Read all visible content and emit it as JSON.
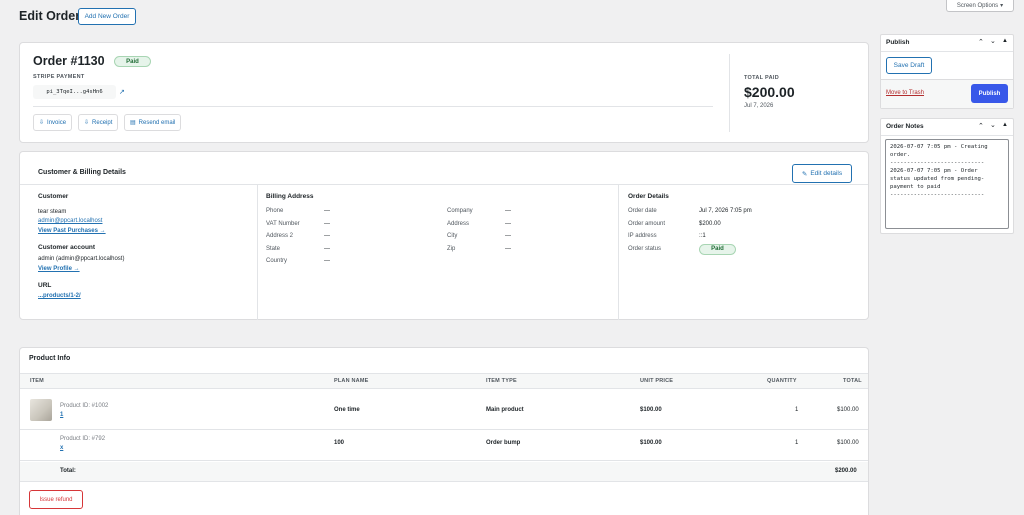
{
  "header": {
    "title": "Edit Order",
    "add_new_label": "Add New Order",
    "screen_options_label": "Screen Options"
  },
  "order": {
    "title": "Order #1130",
    "status_badge": "Paid",
    "payment_label": "STRIPE PAYMENT",
    "payment_id": "pi_3TqeI...g4sHn6",
    "invoice_label": "Invoice",
    "receipt_label": "Receipt",
    "resend_label": "Resend email",
    "total_paid_label": "TOTAL PAID",
    "total_paid": "$200.00",
    "date": "Jul 7, 2026"
  },
  "customer_section": {
    "title": "Customer & Billing Details",
    "edit_label": "Edit details",
    "customer_heading": "Customer",
    "customer_name": "tear steam",
    "customer_email": "admin@ppcart.localhost",
    "view_purchases": "View Past Purchases →",
    "account_heading": "Customer account",
    "account_value": "admin (admin@ppcart.localhost)",
    "view_profile": "View Profile →",
    "url_heading": "URL",
    "url_value": "...products/1-2/",
    "billing_heading": "Billing Address",
    "billing_left": [
      {
        "label": "Phone",
        "value": "—"
      },
      {
        "label": "VAT Number",
        "value": "—"
      },
      {
        "label": "Address 2",
        "value": "—"
      },
      {
        "label": "State",
        "value": "—"
      },
      {
        "label": "Country",
        "value": "—"
      }
    ],
    "billing_right": [
      {
        "label": "Company",
        "value": "—"
      },
      {
        "label": "Address",
        "value": "—"
      },
      {
        "label": "City",
        "value": "—"
      },
      {
        "label": "Zip",
        "value": "—"
      }
    ],
    "order_details_heading": "Order Details",
    "order_details": [
      {
        "label": "Order date",
        "value": "Jul 7, 2026 7:05 pm"
      },
      {
        "label": "Order amount",
        "value": "$200.00"
      },
      {
        "label": "IP address",
        "value": "::1"
      },
      {
        "label": "Order status",
        "value": "Paid"
      }
    ]
  },
  "products": {
    "title": "Product Info",
    "columns": [
      "ITEM",
      "PLAN NAME",
      "ITEM TYPE",
      "UNIT PRICE",
      "QUANTITY",
      "TOTAL"
    ],
    "rows": [
      {
        "product_id": "Product ID: #1002",
        "link": "1",
        "plan": "One time",
        "type": "Main product",
        "unit": "$100.00",
        "qty": "1",
        "total": "$100.00"
      },
      {
        "product_id": "Product ID: #792",
        "link": "x",
        "plan": "100",
        "type": "Order bump",
        "unit": "$100.00",
        "qty": "1",
        "total": "$100.00"
      }
    ],
    "total_label": "Total:",
    "total_value": "$200.00",
    "refund_label": "Issue refund"
  },
  "publish": {
    "title": "Publish",
    "save_draft": "Save Draft",
    "trash": "Move to Trash",
    "publish_btn": "Publish"
  },
  "notes": {
    "title": "Order Notes",
    "content": "2026-07-07 7:05 pm - Creating\norder.\n----------------------------\n2026-07-07 7:05 pm - Order\nstatus updated from pending-\npayment to paid\n----------------------------"
  },
  "colors": {
    "accent": "#2271b1",
    "publish": "#3858e9",
    "paid_bg": "#e6f4ea",
    "danger": "#d63638"
  }
}
